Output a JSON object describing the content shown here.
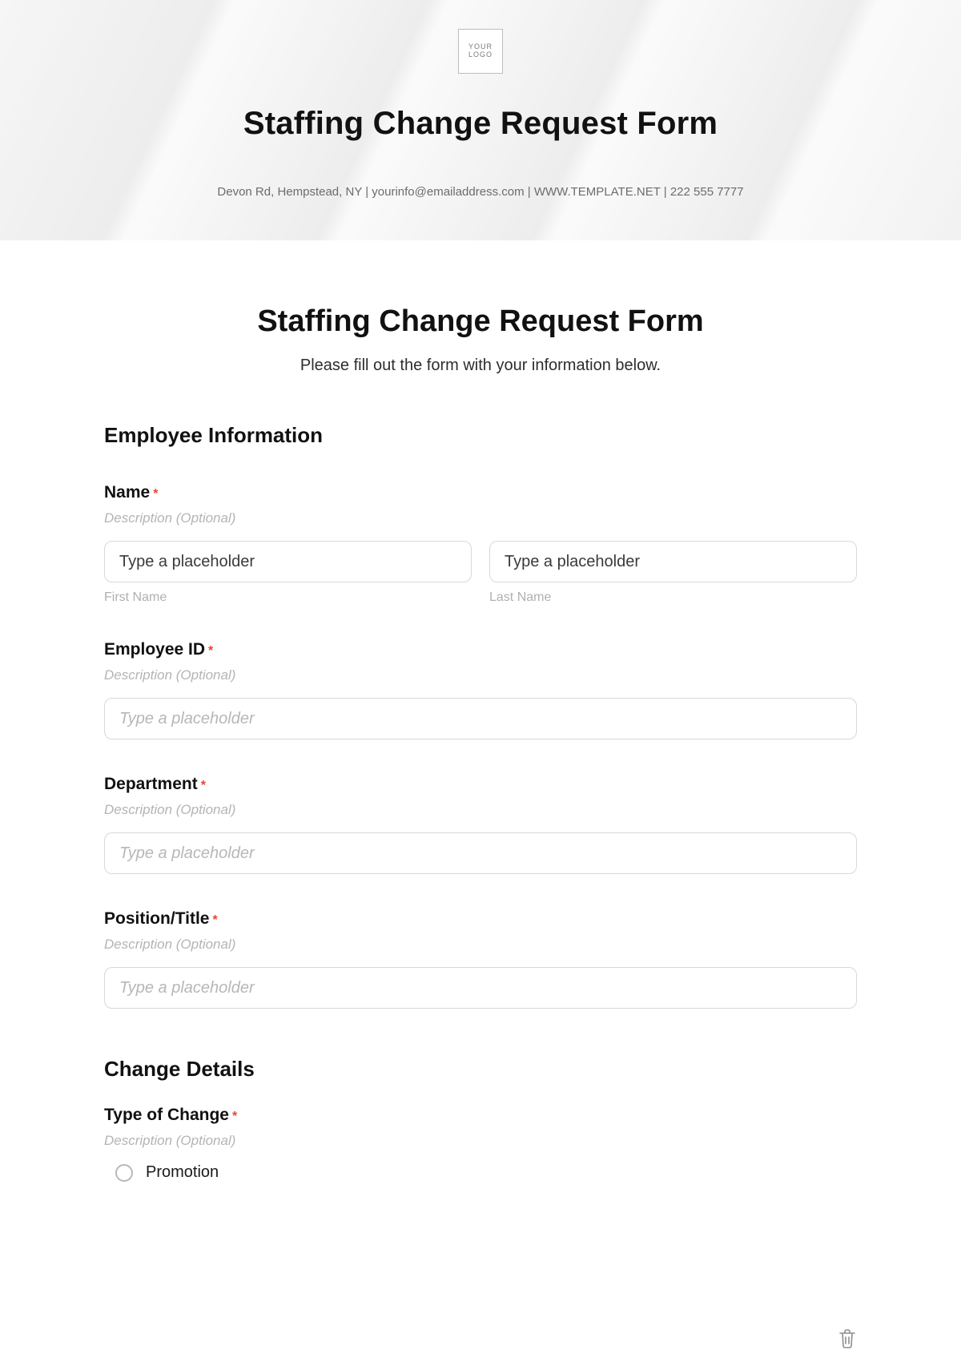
{
  "header": {
    "logo_text": "YOUR LOGO",
    "title": "Staffing Change Request Form",
    "contact_line": "Devon Rd, Hempstead, NY | yourinfo@emailaddress.com | WWW.TEMPLATE.NET | 222 555 7777"
  },
  "form": {
    "title": "Staffing Change Request Form",
    "subtitle": "Please fill out the form with your information below."
  },
  "sections": {
    "employee_info_title": "Employee Information",
    "change_details_title": "Change Details"
  },
  "fields": {
    "name": {
      "label": "Name",
      "required_mark": "*",
      "description": "Description (Optional)",
      "first_placeholder": "Type a placeholder",
      "first_sublabel": "First Name",
      "last_placeholder": "Type a placeholder",
      "last_sublabel": "Last Name"
    },
    "employee_id": {
      "label": "Employee ID",
      "required_mark": "*",
      "description": "Description (Optional)",
      "placeholder": "Type a placeholder"
    },
    "department": {
      "label": "Department",
      "required_mark": "*",
      "description": "Description (Optional)",
      "placeholder": "Type a placeholder"
    },
    "position": {
      "label": "Position/Title",
      "required_mark": "*",
      "description": "Description (Optional)",
      "placeholder": "Type a placeholder"
    },
    "type_of_change": {
      "label": "Type of Change",
      "required_mark": "*",
      "description": "Description (Optional)",
      "options": {
        "0": "Promotion"
      }
    }
  }
}
